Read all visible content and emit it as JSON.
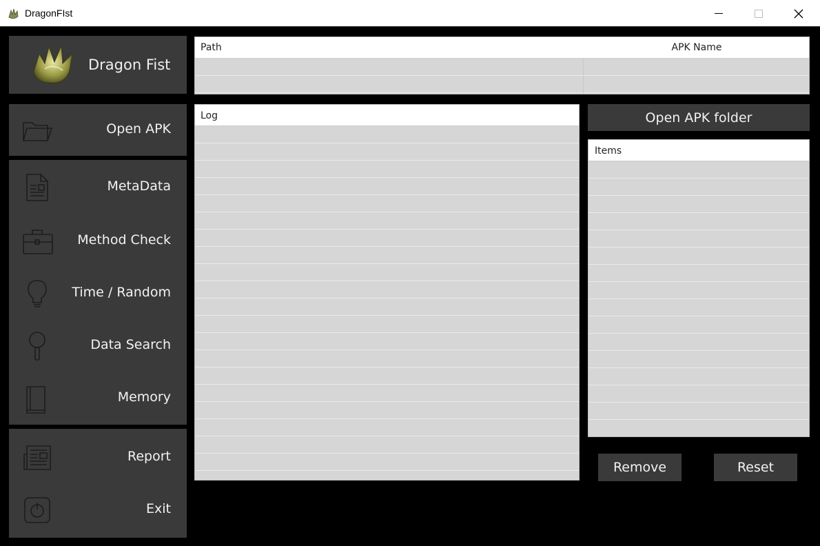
{
  "window": {
    "title": "DragonFIst",
    "app_icon": "dragon-claw-icon",
    "controls": [
      "minimize-icon",
      "maximize-icon",
      "close-icon"
    ]
  },
  "logo": {
    "text": "Dragon Fist",
    "image": "dragon-claw-icon"
  },
  "sidebar": {
    "open_group": [
      {
        "label": "Open APK",
        "icon": "folder-icon"
      }
    ],
    "analysis_group": [
      {
        "label": "MetaData",
        "icon": "document-icon"
      },
      {
        "label": "Method Check",
        "icon": "briefcase-icon"
      },
      {
        "label": "Time / Random",
        "icon": "lightbulb-icon"
      },
      {
        "label": "Data Search",
        "icon": "magnifier-icon"
      },
      {
        "label": "Memory",
        "icon": "book-icon"
      }
    ],
    "report_group": [
      {
        "label": "Report",
        "icon": "newspaper-icon"
      },
      {
        "label": "Exit",
        "icon": "power-icon"
      }
    ]
  },
  "path_table": {
    "columns": [
      "Path",
      "APK Name"
    ],
    "rows": [
      [
        "",
        ""
      ],
      [
        "",
        ""
      ]
    ]
  },
  "log": {
    "header": "Log",
    "rows": []
  },
  "items": {
    "header": "Items",
    "rows": []
  },
  "buttons": {
    "open_folder": "Open APK folder",
    "remove": "Remove",
    "reset": "Reset"
  },
  "colors": {
    "background": "#000000",
    "panel": "#3a3a3a",
    "grid_fill": "#d6d6d6",
    "text_light": "#f2f2f2"
  }
}
